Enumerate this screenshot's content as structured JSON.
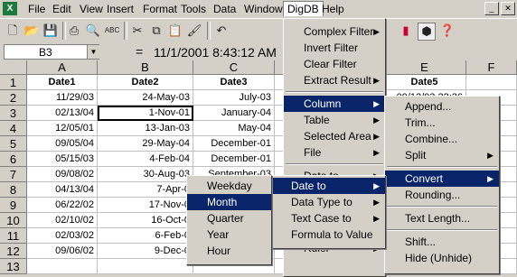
{
  "menubar": {
    "app_icon": "excel-icon",
    "items": [
      "File",
      "Edit",
      "View",
      "Insert",
      "Format",
      "Tools",
      "Data",
      "Window",
      "DigDB",
      "Help"
    ]
  },
  "toolbar": {
    "icons": [
      "new-icon",
      "open-icon",
      "save-icon",
      "print-icon",
      "print-preview-icon",
      "spelling-icon",
      "cut-icon",
      "copy-icon",
      "paste-icon",
      "format-painter-icon",
      "undo-icon",
      "chart-icon",
      "digdb-icon",
      "help-icon"
    ],
    "abc_label": "ABC"
  },
  "formula_bar": {
    "name_box": "B3",
    "equals": "=",
    "value": "11/1/2001  8:43:12 AM"
  },
  "columns": [
    "A",
    "B",
    "C",
    "D",
    "E",
    "F"
  ],
  "rows": [
    "1",
    "2",
    "3",
    "4",
    "5",
    "6",
    "7",
    "8",
    "9",
    "10",
    "11",
    "12",
    "13"
  ],
  "cells": {
    "A": [
      "Date1",
      "11/29/03",
      "02/13/04",
      "12/05/01",
      "09/05/04",
      "05/15/03",
      "09/08/02",
      "04/13/04",
      "06/22/02",
      "02/10/02",
      "02/03/02",
      "09/06/02",
      ""
    ],
    "B": [
      "Date2",
      "24-May-03",
      "1-Nov-01",
      "13-Jan-03",
      "29-May-04",
      "4-Feb-04",
      "30-Aug-03",
      "7-Apr-0",
      "17-Nov-0",
      "16-Oct-0",
      "6-Feb-0",
      "9-Dec-0",
      ""
    ],
    "C": [
      "Date3",
      "July-03",
      "January-04",
      "May-04",
      "December-01",
      "December-01",
      "September-03",
      "",
      "",
      "",
      "",
      "",
      ""
    ],
    "E": [
      "Date5",
      "09/12/03 22:26",
      "",
      "",
      "",
      "",
      "",
      "",
      "",
      "",
      "",
      "",
      ""
    ]
  },
  "digdb_menu": [
    {
      "label": "Complex Filter",
      "sub": true
    },
    {
      "label": "Invert Filter",
      "sub": false
    },
    {
      "label": "Clear Filter",
      "sub": false
    },
    {
      "label": "Extract Result",
      "sub": true
    },
    {
      "sep": true
    },
    {
      "label": "Column",
      "sub": true,
      "hl": true
    },
    {
      "label": "Table",
      "sub": true
    },
    {
      "label": "Selected Area",
      "sub": true
    },
    {
      "label": "File",
      "sub": true
    },
    {
      "sep": true
    },
    {
      "label": "Date to",
      "sub": true
    },
    {
      "label": "Data Type to",
      "sub": true
    },
    {
      "label": "Text Case to",
      "sub": true
    },
    {
      "label": "Formula to Value",
      "sub": false
    },
    {
      "sep": true
    },
    {
      "label": "Ruler",
      "sub": true
    }
  ],
  "column_menu": [
    {
      "label": "Append..."
    },
    {
      "label": "Trim..."
    },
    {
      "label": "Combine..."
    },
    {
      "label": "Split",
      "sub": true
    },
    {
      "sep": true
    },
    {
      "label": "Convert",
      "sub": true,
      "hl": true
    },
    {
      "label": "Rounding..."
    },
    {
      "sep": true
    },
    {
      "label": "Text Length..."
    },
    {
      "sep": true
    },
    {
      "label": "Shift..."
    },
    {
      "label": "Hide (Unhide)"
    }
  ],
  "convert_menu": [
    {
      "label": "Date to",
      "sub": true,
      "hl": true
    },
    {
      "label": "Data Type to",
      "sub": true
    },
    {
      "label": "Text Case to",
      "sub": true
    },
    {
      "label": "Formula to Value"
    }
  ],
  "date_to_menu": [
    {
      "label": "Weekday"
    },
    {
      "label": "Month",
      "hl": true
    },
    {
      "label": "Quarter"
    },
    {
      "label": "Year"
    },
    {
      "label": "Hour"
    }
  ],
  "colors": {
    "highlight": "#0a246a",
    "face": "#d4d0c8"
  }
}
